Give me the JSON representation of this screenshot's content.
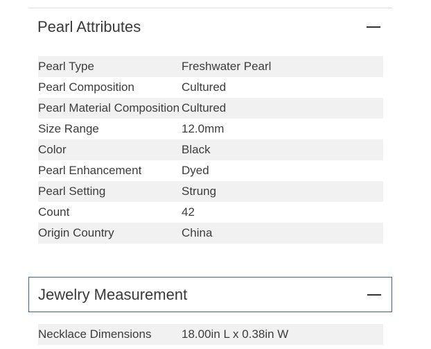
{
  "pearl_section": {
    "title": "Pearl Attributes",
    "expanded": true,
    "icon": "minus-icon",
    "rows": [
      {
        "label": "Pearl Type",
        "value": "Freshwater Pearl"
      },
      {
        "label": "Pearl Composition",
        "value": "Cultured"
      },
      {
        "label": "Pearl Material Composition",
        "value": "Cultured"
      },
      {
        "label": "Size Range",
        "value": "12.0mm"
      },
      {
        "label": "Color",
        "value": "Black"
      },
      {
        "label": "Pearl Enhancement",
        "value": "Dyed"
      },
      {
        "label": "Pearl Setting",
        "value": "Strung"
      },
      {
        "label": "Count",
        "value": "42"
      },
      {
        "label": "Origin Country",
        "value": "China"
      }
    ]
  },
  "jewelry_section": {
    "title": "Jewelry Measurement",
    "expanded": true,
    "icon": "minus-icon",
    "border_color": "#3f5f86",
    "rows": [
      {
        "label": "Necklace Dimensions",
        "value": "18.00in L x 0.38in W"
      }
    ]
  },
  "colors": {
    "row_shade": "#f1f1f1",
    "text": "#333333"
  }
}
